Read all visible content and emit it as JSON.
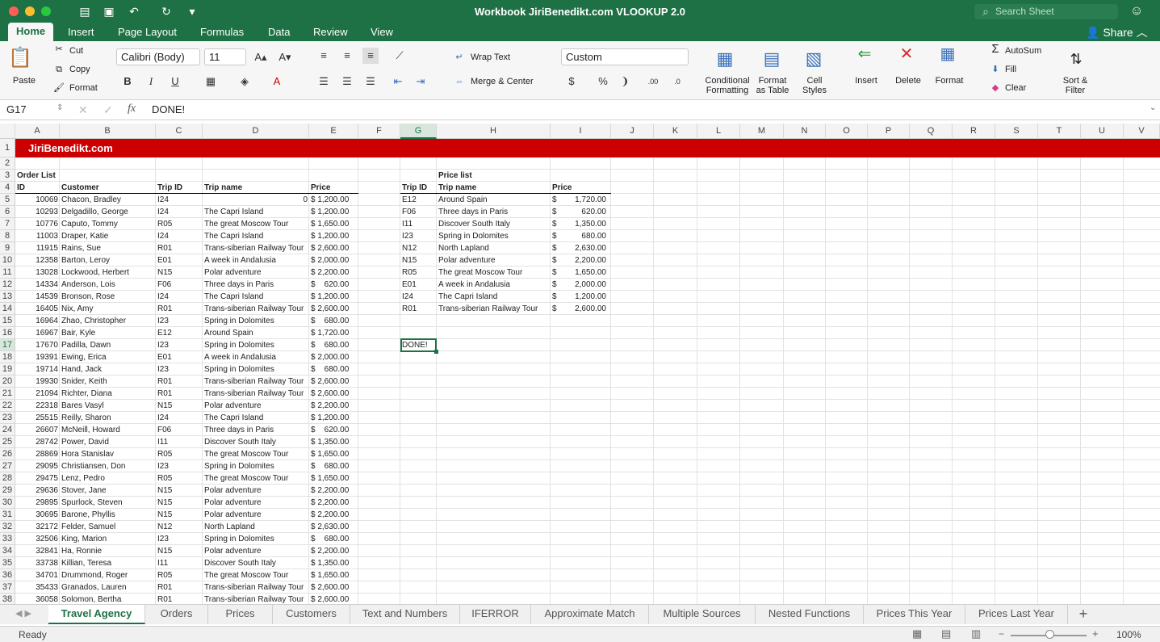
{
  "window": {
    "title": "Workbook JiriBenedikt.com VLOOKUP 2.0",
    "search_placeholder": "Search Sheet"
  },
  "ribbon_tabs": [
    "Home",
    "Insert",
    "Page Layout",
    "Formulas",
    "Data",
    "Review",
    "View"
  ],
  "share_label": "Share",
  "ribbon": {
    "paste": "Paste",
    "cut": "Cut",
    "copy": "Copy",
    "format": "Format",
    "font_name": "Calibri (Body)",
    "font_size": "11",
    "wrap_text": "Wrap Text",
    "merge_center": "Merge & Center",
    "number_format": "Custom",
    "conditional_formatting": "Conditional\nFormatting",
    "format_as_table": "Format\nas Table",
    "cell_styles": "Cell\nStyles",
    "insert": "Insert",
    "delete": "Delete",
    "format_cells": "Format",
    "autosum": "AutoSum",
    "fill": "Fill",
    "clear": "Clear",
    "sort_filter": "Sort &\nFilter"
  },
  "formula_bar": {
    "name_box": "G17",
    "formula": "DONE!"
  },
  "columns": [
    "A",
    "B",
    "C",
    "D",
    "E",
    "F",
    "G",
    "H",
    "I",
    "J",
    "K",
    "L",
    "M",
    "N",
    "O",
    "P",
    "Q",
    "R",
    "S",
    "T",
    "U",
    "V"
  ],
  "banner": "JiriBenedikt.com",
  "order_list": {
    "title": "Order List",
    "headers": [
      "ID",
      "Customer",
      "Trip ID",
      "Trip name",
      "Price"
    ],
    "rows": [
      [
        "10069",
        "Chacon, Bradley",
        "I24",
        "0",
        "$ 1,200.00"
      ],
      [
        "10293",
        "Delgadillo, George",
        "I24",
        "The Capri Island",
        "$ 1,200.00"
      ],
      [
        "10776",
        "Caputo, Tommy",
        "R05",
        "The great Moscow Tour",
        "$ 1,650.00"
      ],
      [
        "11003",
        "Draper, Katie",
        "I24",
        "The Capri Island",
        "$ 1,200.00"
      ],
      [
        "11915",
        "Rains, Sue",
        "R01",
        "Trans-siberian Railway Tour",
        "$ 2,600.00"
      ],
      [
        "12358",
        "Barton, Leroy",
        "E01",
        "A week in Andalusia",
        "$ 2,000.00"
      ],
      [
        "13028",
        "Lockwood, Herbert",
        "N15",
        "Polar adventure",
        "$ 2,200.00"
      ],
      [
        "14334",
        "Anderson, Lois",
        "F06",
        "Three days in Paris",
        "$    620.00"
      ],
      [
        "14539",
        "Bronson, Rose",
        "I24",
        "The Capri Island",
        "$ 1,200.00"
      ],
      [
        "16405",
        "Nix, Amy",
        "R01",
        "Trans-siberian Railway Tour",
        "$ 2,600.00"
      ],
      [
        "16964",
        "Zhao, Christopher",
        "I23",
        "Spring in Dolomites",
        "$    680.00"
      ],
      [
        "16967",
        "Bair, Kyle",
        "E12",
        "Around Spain",
        "$ 1,720.00"
      ],
      [
        "17670",
        "Padilla, Dawn",
        "I23",
        "Spring in Dolomites",
        "$    680.00"
      ],
      [
        "19391",
        "Ewing, Erica",
        "E01",
        "A week in Andalusia",
        "$ 2,000.00"
      ],
      [
        "19714",
        "Hand, Jack",
        "I23",
        "Spring in Dolomites",
        "$    680.00"
      ],
      [
        "19930",
        "Snider, Keith",
        "R01",
        "Trans-siberian Railway Tour",
        "$ 2,600.00"
      ],
      [
        "21094",
        "Richter, Diana",
        "R01",
        "Trans-siberian Railway Tour",
        "$ 2,600.00"
      ],
      [
        "22318",
        "Bares Vasyl",
        "N15",
        "Polar adventure",
        "$ 2,200.00"
      ],
      [
        "25515",
        "Reilly, Sharon",
        "I24",
        "The Capri Island",
        "$ 1,200.00"
      ],
      [
        "26607",
        "McNeill, Howard",
        "F06",
        "Three days in Paris",
        "$    620.00"
      ],
      [
        "28742",
        "Power, David",
        "I11",
        "Discover South Italy",
        "$ 1,350.00"
      ],
      [
        "28869",
        "Hora Stanislav",
        "R05",
        "The great Moscow Tour",
        "$ 1,650.00"
      ],
      [
        "29095",
        "Christiansen, Don",
        "I23",
        "Spring in Dolomites",
        "$    680.00"
      ],
      [
        "29475",
        "Lenz, Pedro",
        "R05",
        "The great Moscow Tour",
        "$ 1,650.00"
      ],
      [
        "29636",
        "Stover, Jane",
        "N15",
        "Polar adventure",
        "$ 2,200.00"
      ],
      [
        "29895",
        "Spurlock, Steven",
        "N15",
        "Polar adventure",
        "$ 2,200.00"
      ],
      [
        "30695",
        "Barone, Phyllis",
        "N15",
        "Polar adventure",
        "$ 2,200.00"
      ],
      [
        "32172",
        "Felder, Samuel",
        "N12",
        "North Lapland",
        "$ 2,630.00"
      ],
      [
        "32506",
        "King, Marion",
        "I23",
        "Spring in Dolomites",
        "$    680.00"
      ],
      [
        "32841",
        "Ha, Ronnie",
        "N15",
        "Polar adventure",
        "$ 2,200.00"
      ],
      [
        "33738",
        "Killian, Teresa",
        "I11",
        "Discover South Italy",
        "$ 1,350.00"
      ],
      [
        "34701",
        "Drummond, Roger",
        "R05",
        "The great Moscow Tour",
        "$ 1,650.00"
      ],
      [
        "35433",
        "Granados, Lauren",
        "R01",
        "Trans-siberian Railway Tour",
        "$ 2,600.00"
      ],
      [
        "36058",
        "Solomon, Bertha",
        "R01",
        "Trans-siberian Railway Tour",
        "$ 2,600.00"
      ]
    ]
  },
  "price_list": {
    "title": "Price list",
    "headers": [
      "Trip ID",
      "Trip name",
      "Price"
    ],
    "rows": [
      [
        "E12",
        "Around Spain",
        "$",
        "1,720.00"
      ],
      [
        "F06",
        "Three days in Paris",
        "$",
        "620.00"
      ],
      [
        "I11",
        "Discover South Italy",
        "$",
        "1,350.00"
      ],
      [
        "I23",
        "Spring in Dolomites",
        "$",
        "680.00"
      ],
      [
        "N12",
        "North Lapland",
        "$",
        "2,630.00"
      ],
      [
        "N15",
        "Polar adventure",
        "$",
        "2,200.00"
      ],
      [
        "R05",
        "The great Moscow Tour",
        "$",
        "1,650.00"
      ],
      [
        "E01",
        "A week in Andalusia",
        "$",
        "2,000.00"
      ],
      [
        "I24",
        "The Capri Island",
        "$",
        "1,200.00"
      ],
      [
        "R01",
        "Trans-siberian Railway Tour",
        "$",
        "2,600.00"
      ]
    ]
  },
  "active_cell_value": "DONE!",
  "sheet_tabs": [
    "Travel Agency",
    "Orders",
    "Prices",
    "Customers",
    "Text and Numbers",
    "IFERROR",
    "Approximate Match",
    "Multiple Sources",
    "Nested Functions",
    "Prices This Year",
    "Prices Last Year"
  ],
  "status": {
    "text": "Ready",
    "zoom": "100%"
  },
  "colors": {
    "green": "#1e7145",
    "banner": "#cc0000"
  }
}
